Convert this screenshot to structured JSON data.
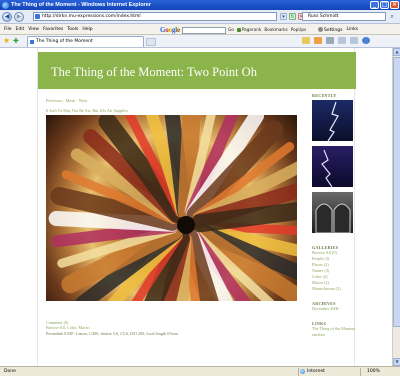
{
  "window": {
    "title": "The Thing of the Moment - Windows Internet Explorer",
    "minimize_glyph": "_",
    "maximize_glyph": "□",
    "close_glyph": "×"
  },
  "address_bar": {
    "back_glyph": "◀",
    "forward_glyph": "▶",
    "url": "http://dirkn.mu-expressions.com/index.html",
    "search_value": "Russ Schmidt"
  },
  "menu": [
    "File",
    "Edit",
    "View",
    "Favorites",
    "Tools",
    "Help"
  ],
  "google_toolbar": {
    "search_label": "Go",
    "tools": [
      "Pagerank",
      "Bookmarks",
      "PopUps"
    ],
    "settings_label": "Settings",
    "links_label": "Links"
  },
  "tabs": [
    {
      "label": "The Thing of the Moment"
    }
  ],
  "blog": {
    "title": "The Thing of the Moment: Two Point Oh",
    "post_nav": "Previous - Main - Next",
    "post_subtitle": "It Isn't Or May Not Be Art, But It Is Art Supplies",
    "footer": {
      "comments": "Comment (0)",
      "browse": "Browse All, Color, Macro",
      "permalink": "Permalink EXIF: Canon, 1/400, shutter 5.6, f/5.6, ISO 200, focal length 67mm"
    }
  },
  "sidebar": {
    "recently_heading": "RECENTLY",
    "galleries_heading": "GALLERIES",
    "galleries": [
      "Browse All (9)",
      "People (3)",
      "Places (2)",
      "Nature (3)",
      "Color (2)",
      "Macro (2)",
      "Monochrome (3)"
    ],
    "archives_heading": "ARCHIVES",
    "archives": [
      "December 2006"
    ],
    "links_heading": "LINKS",
    "links": [
      "The Thing of the Moment",
      "random"
    ]
  },
  "status": {
    "text": "Done",
    "zone": "Internet",
    "zoom": "100%"
  },
  "colors": {
    "header_green": "#8bb44a",
    "link_green": "#8aa65a",
    "titlebar_blue": "#2a63d8"
  }
}
